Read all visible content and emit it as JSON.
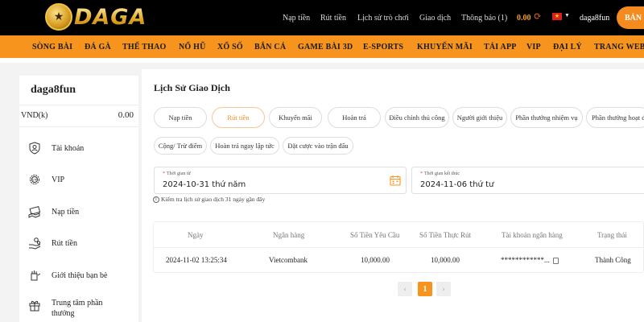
{
  "header": {
    "logo_text": "DAGA",
    "nav": [
      "Nạp tiền",
      "Rút tiền",
      "Lịch sử trò chơi",
      "Giao dịch",
      "Thông báo (1)"
    ],
    "balance": "0.00",
    "username": "daga8fun",
    "bank_button": "BẢN",
    "icons": [
      "refresh-icon",
      "vietnam-flag-icon",
      "caret-down-icon"
    ]
  },
  "categories": [
    "SÒNG BÀI",
    "ĐÁ GÀ",
    "THỂ THAO",
    "NỔ HŨ",
    "XỔ SỐ",
    "BẮN CÁ",
    "GAME BÀI 3D",
    "E-SPORTS",
    "KHUYẾN MÃI",
    "TẢI APP",
    "VIP",
    "ĐẠI LÝ",
    "TRANG WEB"
  ],
  "sidebar": {
    "username": "daga8fun",
    "currency": "VND(k)",
    "amount": "0.00",
    "items": [
      {
        "label": "Tài khoản",
        "icon": "account-shield-icon"
      },
      {
        "label": "VIP",
        "icon": "vip-gear-icon"
      },
      {
        "label": "Nạp tiền",
        "icon": "deposit-money-icon"
      },
      {
        "label": "Rút tiền",
        "icon": "withdraw-hand-icon"
      },
      {
        "label": "Giới thiệu bạn bè",
        "icon": "referral-icon"
      },
      {
        "label": "Trung tâm phần thưởng",
        "icon": "gift-icon"
      }
    ]
  },
  "main": {
    "title": "Lịch Sử Giao Dịch",
    "filters_row1": [
      "Nạp tiền",
      "Rút tiền",
      "Khuyến mãi",
      "Hoàn trả",
      "Điều chỉnh thủ công",
      "Người giới thiệu",
      "Phần thưởng nhiệm vụ",
      "Phần thưởng hoạt động"
    ],
    "active_filter": "Rút tiền",
    "filters_row2": [
      "Cộng/ Trừ điểm",
      "Hoàn trả ngay lập tức",
      "Đặt cược vào trận đấu"
    ],
    "start_date_label": "Thời gian từ",
    "start_date": "2024-10-31 thứ năm",
    "end_date_label": "Thời gian kết thúc",
    "end_date": "2024-11-06 thứ tư",
    "hint": "Kiểm tra lịch sử giao dịch 31 ngày gần đây",
    "table": {
      "columns": [
        "Ngày",
        "Ngân hàng",
        "Số Tiền Yêu Cầu",
        "Số Tiền Thực Rút",
        "Tài khoản ngân hàng",
        "Trạng thái"
      ],
      "rows": [
        [
          "2024-11-02 13:25:34",
          "Vietcombank",
          "10,000.00",
          "10,000.00",
          "************...",
          "Thành Công"
        ]
      ]
    },
    "pagination": {
      "prev": "‹",
      "current": "1",
      "next": "›"
    }
  },
  "colors": {
    "accent": "#f7941d",
    "header_bg": "#000000",
    "gold": "#e3a928"
  }
}
